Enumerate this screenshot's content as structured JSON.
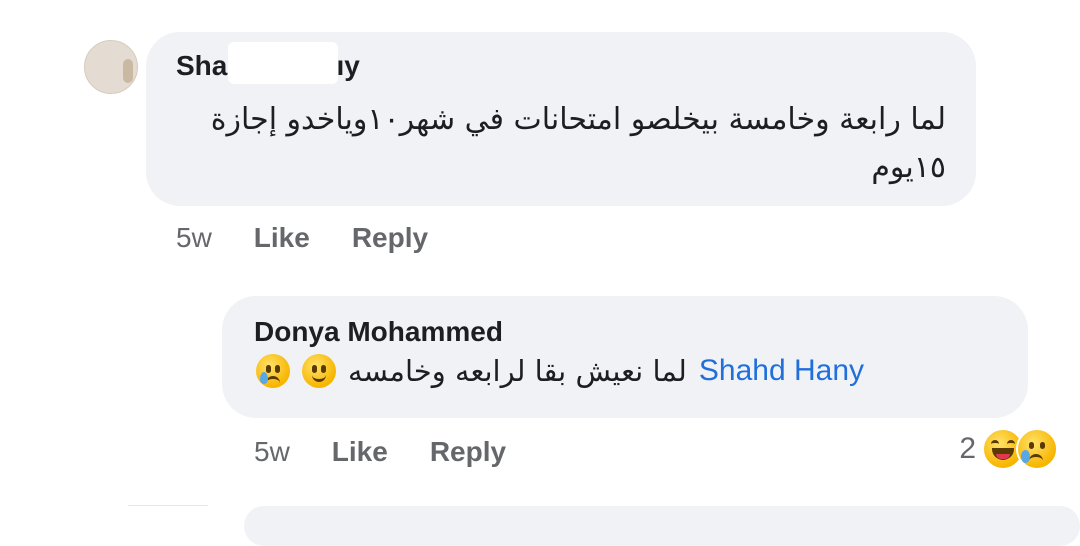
{
  "comments": [
    {
      "author_visible": "Shan",
      "author_tail": "ıy",
      "text": "لما رابعة وخامسة بيخلصو امتحانات في شهر١٠وياخدو إجازة ١٥يوم",
      "time": "5w",
      "like_label": "Like",
      "reply_label": "Reply"
    },
    {
      "author": "Donya Mohammed",
      "mention": "Shahd Hany",
      "text": "لما نعيش بقا لرابعه وخامسه",
      "emojis": [
        "slightly-smiling-face-icon",
        "crying-face-icon"
      ],
      "time": "5w",
      "like_label": "Like",
      "reply_label": "Reply",
      "reaction_count": "2",
      "reactions": [
        "haha-reaction-icon",
        "sad-reaction-icon"
      ]
    }
  ],
  "colors": {
    "bubble": "#f0f2f5",
    "mention": "#216fdb",
    "meta": "#65676b",
    "text": "#1c1e21"
  }
}
